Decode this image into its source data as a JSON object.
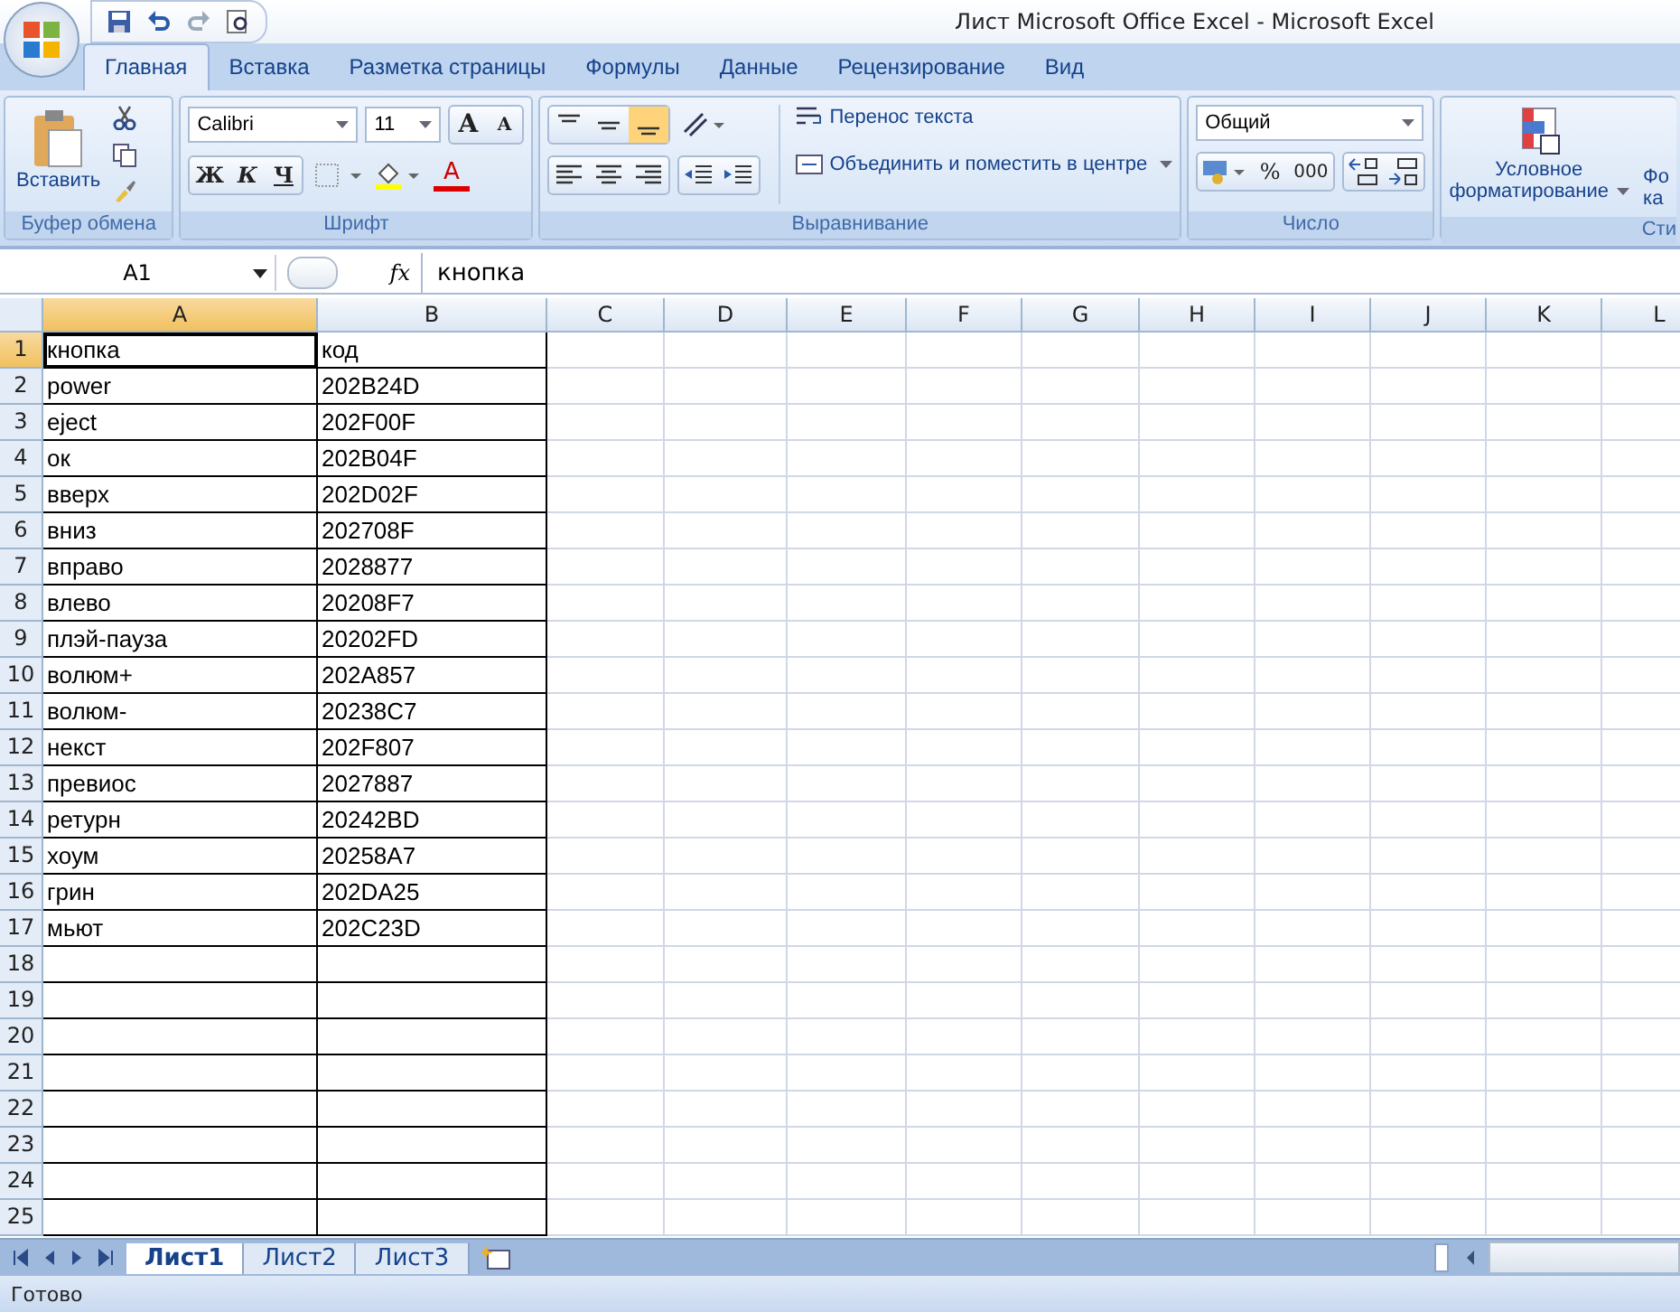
{
  "window": {
    "title": "Лист Microsoft Office Excel - Microsoft Excel"
  },
  "tabs": [
    {
      "label": "Главная",
      "selected": true
    },
    {
      "label": "Вставка",
      "selected": false
    },
    {
      "label": "Разметка страницы",
      "selected": false
    },
    {
      "label": "Формулы",
      "selected": false
    },
    {
      "label": "Данные",
      "selected": false
    },
    {
      "label": "Рецензирование",
      "selected": false
    },
    {
      "label": "Вид",
      "selected": false
    }
  ],
  "ribbon": {
    "clipboard": {
      "paste": "Вставить",
      "label": "Буфер обмена"
    },
    "font": {
      "name": "Calibri",
      "size": "11",
      "grow": "A",
      "shrink": "A",
      "bold": "Ж",
      "italic": "К",
      "underline": "Ч",
      "font_color_letter": "A",
      "label": "Шрифт"
    },
    "alignment": {
      "valign": [
        {
          "selected": false
        },
        {
          "selected": false
        },
        {
          "selected": true
        }
      ],
      "wrap": "Перенос текста",
      "merge": "Объединить и поместить в центре",
      "label": "Выравнивание"
    },
    "number": {
      "format": "Общий",
      "percent": "%",
      "thousands": "000",
      "label": "Число"
    },
    "styles": {
      "conditional": [
        "Условное",
        "форматирование"
      ],
      "cut_button": [
        "Фо",
        "ка"
      ],
      "label": "Сти"
    }
  },
  "formula_bar": {
    "cell": "A1",
    "fx": "fx",
    "value": "кнопка"
  },
  "sheet": {
    "columns": [
      {
        "label": "A",
        "selected": true
      },
      {
        "label": "B",
        "selected": false
      },
      {
        "label": "C",
        "selected": false
      },
      {
        "label": "D",
        "selected": false
      },
      {
        "label": "E",
        "selected": false
      },
      {
        "label": "F",
        "selected": false
      },
      {
        "label": "G",
        "selected": false
      },
      {
        "label": "H",
        "selected": false
      },
      {
        "label": "I",
        "selected": false
      },
      {
        "label": "J",
        "selected": false
      },
      {
        "label": "K",
        "selected": false
      },
      {
        "label": "L",
        "selected": false
      }
    ],
    "rows": [
      {
        "number": "1",
        "selected": true,
        "cells": [
          "кнопка",
          "код"
        ]
      },
      {
        "number": "2",
        "selected": false,
        "cells": [
          "power",
          "202B24D"
        ]
      },
      {
        "number": "3",
        "selected": false,
        "cells": [
          "eject",
          "202F00F"
        ]
      },
      {
        "number": "4",
        "selected": false,
        "cells": [
          "ок",
          "202B04F"
        ]
      },
      {
        "number": "5",
        "selected": false,
        "cells": [
          "вверх",
          "202D02F"
        ]
      },
      {
        "number": "6",
        "selected": false,
        "cells": [
          "вниз",
          "202708F"
        ]
      },
      {
        "number": "7",
        "selected": false,
        "cells": [
          "вправо",
          "2028877"
        ]
      },
      {
        "number": "8",
        "selected": false,
        "cells": [
          "влево",
          "20208F7"
        ]
      },
      {
        "number": "9",
        "selected": false,
        "cells": [
          "плэй-пауза",
          "20202FD"
        ]
      },
      {
        "number": "10",
        "selected": false,
        "cells": [
          "волюм+",
          "202A857"
        ]
      },
      {
        "number": "11",
        "selected": false,
        "cells": [
          "волюм-",
          "20238C7"
        ]
      },
      {
        "number": "12",
        "selected": false,
        "cells": [
          "некст",
          "202F807"
        ]
      },
      {
        "number": "13",
        "selected": false,
        "cells": [
          "превиос",
          "2027887"
        ]
      },
      {
        "number": "14",
        "selected": false,
        "cells": [
          "ретурн",
          "20242BD"
        ]
      },
      {
        "number": "15",
        "selected": false,
        "cells": [
          "хоум",
          "20258A7"
        ]
      },
      {
        "number": "16",
        "selected": false,
        "cells": [
          "грин",
          "202DA25"
        ]
      },
      {
        "number": "17",
        "selected": false,
        "cells": [
          "мьют",
          "202C23D"
        ]
      },
      {
        "number": "18",
        "selected": false
      },
      {
        "number": "19",
        "selected": false
      },
      {
        "number": "20",
        "selected": false
      },
      {
        "number": "21",
        "selected": false
      },
      {
        "number": "22",
        "selected": false
      },
      {
        "number": "23",
        "selected": false
      },
      {
        "number": "24",
        "selected": false
      },
      {
        "number": "25",
        "selected": false
      }
    ]
  },
  "sheet_tabs": [
    {
      "label": "Лист1",
      "selected": true
    },
    {
      "label": "Лист2",
      "selected": false
    },
    {
      "label": "Лист3",
      "selected": false
    }
  ],
  "status_bar": {
    "text": "Готово"
  }
}
